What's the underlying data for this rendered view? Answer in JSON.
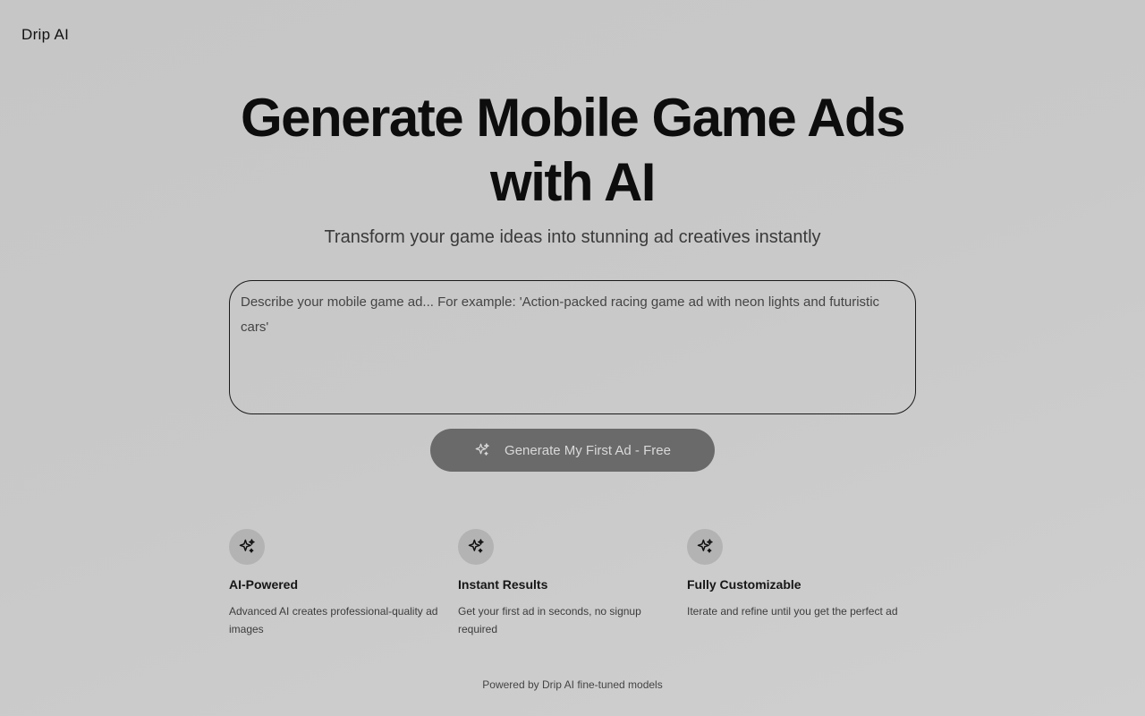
{
  "brand": {
    "name": "Drip AI"
  },
  "hero": {
    "title_line1": "Generate Mobile Game Ads",
    "title_line2": "with AI",
    "subtitle": "Transform your game ideas into stunning ad creatives instantly"
  },
  "prompt": {
    "placeholder": "Describe your mobile game ad... For example: 'Action-packed racing game ad with neon lights and futuristic cars'",
    "value": ""
  },
  "cta": {
    "label": "Generate My First Ad - Free",
    "icon": "sparkles-icon"
  },
  "features": [
    {
      "icon": "sparkles-icon",
      "title": "AI-Powered",
      "description": "Advanced AI creates professional-quality ad images"
    },
    {
      "icon": "sparkles-icon",
      "title": "Instant Results",
      "description": "Get your first ad in seconds, no signup required"
    },
    {
      "icon": "sparkles-icon",
      "title": "Fully Customizable",
      "description": "Iterate and refine until you get the perfect ad"
    }
  ],
  "footer": {
    "text": "Powered by Drip AI fine-tuned models"
  },
  "colors": {
    "background": "#c9c9c9",
    "button": "#6a6a6a",
    "button_text": "#d9d9d9",
    "icon_circle": "#b3b3b3",
    "text": "#111111"
  }
}
